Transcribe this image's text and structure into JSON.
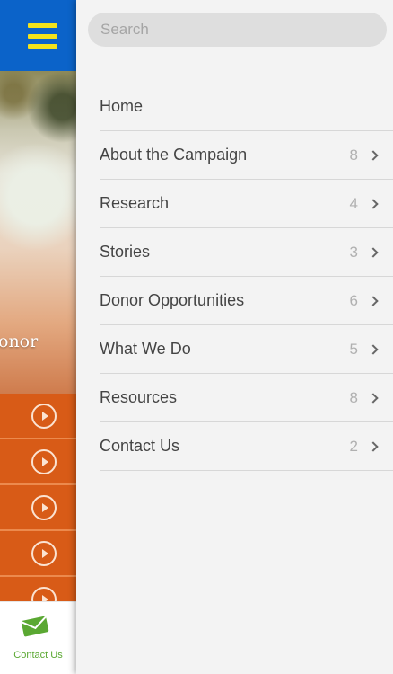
{
  "app": {
    "hero_text": "onor",
    "bottom_tab": {
      "label": "Contact Us",
      "icon": "mail-icon"
    }
  },
  "drawer": {
    "search": {
      "placeholder": "Search",
      "value": ""
    },
    "items": [
      {
        "label": "Home",
        "count": ""
      },
      {
        "label": "About the Campaign",
        "count": "8"
      },
      {
        "label": "Research",
        "count": "4"
      },
      {
        "label": "Stories",
        "count": "3"
      },
      {
        "label": "Donor Opportunities",
        "count": "6"
      },
      {
        "label": "What We Do",
        "count": "5"
      },
      {
        "label": "Resources",
        "count": "8"
      },
      {
        "label": "Contact Us",
        "count": "2"
      }
    ]
  },
  "colors": {
    "topbar": "#0b63c9",
    "hamburger": "#f2e21c",
    "orange_row": "#d85b17",
    "contact_green": "#5aa832",
    "drawer_bg": "#f3f3f3"
  }
}
